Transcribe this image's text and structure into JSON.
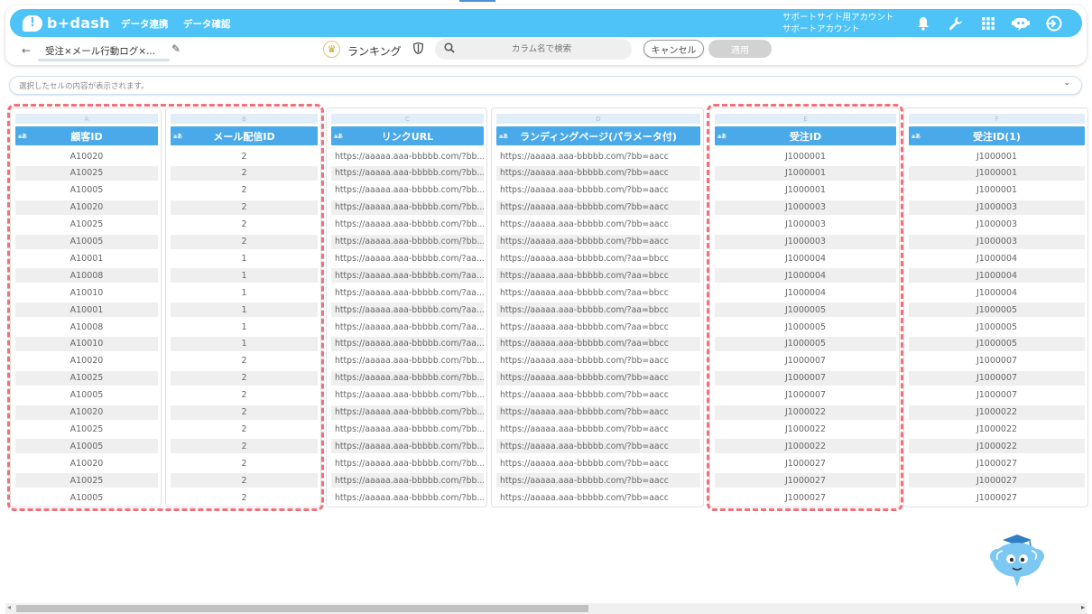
{
  "app": {
    "logo_text": "b+dash",
    "nav": [
      "データ連携",
      "データ確認"
    ],
    "account_line1": "サポートサイト用アカウント",
    "account_line2": "サポートアカウント",
    "icons": [
      "bell-icon",
      "wrench-icon",
      "apps-grid-icon",
      "chat-bot-icon",
      "logout-icon"
    ]
  },
  "toolbar": {
    "back": "←",
    "breadcrumb": "受注×メール行動ログ×...",
    "ranking_label": "ランキング",
    "search_placeholder": "カラム名で検索",
    "cancel_label": "キャンセル",
    "apply_label": "適用"
  },
  "cellbar": {
    "placeholder": "選択したセルの内容が表示されます。"
  },
  "type_tag": "aあ",
  "columns": [
    {
      "letter": "A",
      "header": "顧客ID",
      "highlighted": true,
      "cells": [
        "A10020",
        "A10025",
        "A10005",
        "A10020",
        "A10025",
        "A10005",
        "A10001",
        "A10008",
        "A10010",
        "A10001",
        "A10008",
        "A10010",
        "A10020",
        "A10025",
        "A10005",
        "A10020",
        "A10025",
        "A10005",
        "A10020",
        "A10025",
        "A10005"
      ]
    },
    {
      "letter": "B",
      "header": "メール配信ID",
      "highlighted": true,
      "cells": [
        "2",
        "2",
        "2",
        "2",
        "2",
        "2",
        "1",
        "1",
        "1",
        "1",
        "1",
        "1",
        "2",
        "2",
        "2",
        "2",
        "2",
        "2",
        "2",
        "2",
        "2"
      ]
    },
    {
      "letter": "C",
      "header": "リンクURL",
      "highlighted": false,
      "cells": [
        "https://aaaaa.aaa-bbbbb.com/?bb...",
        "https://aaaaa.aaa-bbbbb.com/?bb...",
        "https://aaaaa.aaa-bbbbb.com/?bb...",
        "https://aaaaa.aaa-bbbbb.com/?bb...",
        "https://aaaaa.aaa-bbbbb.com/?bb...",
        "https://aaaaa.aaa-bbbbb.com/?bb...",
        "https://aaaaa.aaa-bbbbb.com/?aa...",
        "https://aaaaa.aaa-bbbbb.com/?aa...",
        "https://aaaaa.aaa-bbbbb.com/?aa...",
        "https://aaaaa.aaa-bbbbb.com/?aa...",
        "https://aaaaa.aaa-bbbbb.com/?aa...",
        "https://aaaaa.aaa-bbbbb.com/?aa...",
        "https://aaaaa.aaa-bbbbb.com/?bb...",
        "https://aaaaa.aaa-bbbbb.com/?bb...",
        "https://aaaaa.aaa-bbbbb.com/?bb...",
        "https://aaaaa.aaa-bbbbb.com/?bb...",
        "https://aaaaa.aaa-bbbbb.com/?bb...",
        "https://aaaaa.aaa-bbbbb.com/?bb...",
        "https://aaaaa.aaa-bbbbb.com/?bb...",
        "https://aaaaa.aaa-bbbbb.com/?bb...",
        "https://aaaaa.aaa-bbbbb.com/?bb..."
      ]
    },
    {
      "letter": "D",
      "header": "ランディングページ(パラメータ付)",
      "highlighted": false,
      "cells": [
        "https://aaaaa.aaa-bbbbb.com/?bb=aacc",
        "https://aaaaa.aaa-bbbbb.com/?bb=aacc",
        "https://aaaaa.aaa-bbbbb.com/?bb=aacc",
        "https://aaaaa.aaa-bbbbb.com/?bb=aacc",
        "https://aaaaa.aaa-bbbbb.com/?bb=aacc",
        "https://aaaaa.aaa-bbbbb.com/?bb=aacc",
        "https://aaaaa.aaa-bbbbb.com/?aa=bbcc",
        "https://aaaaa.aaa-bbbbb.com/?aa=bbcc",
        "https://aaaaa.aaa-bbbbb.com/?aa=bbcc",
        "https://aaaaa.aaa-bbbbb.com/?aa=bbcc",
        "https://aaaaa.aaa-bbbbb.com/?aa=bbcc",
        "https://aaaaa.aaa-bbbbb.com/?aa=bbcc",
        "https://aaaaa.aaa-bbbbb.com/?bb=aacc",
        "https://aaaaa.aaa-bbbbb.com/?bb=aacc",
        "https://aaaaa.aaa-bbbbb.com/?bb=aacc",
        "https://aaaaa.aaa-bbbbb.com/?bb=aacc",
        "https://aaaaa.aaa-bbbbb.com/?bb=aacc",
        "https://aaaaa.aaa-bbbbb.com/?bb=aacc",
        "https://aaaaa.aaa-bbbbb.com/?bb=aacc",
        "https://aaaaa.aaa-bbbbb.com/?bb=aacc",
        "https://aaaaa.aaa-bbbbb.com/?bb=aacc"
      ]
    },
    {
      "letter": "E",
      "header": "受注ID",
      "highlighted": true,
      "cells": [
        "J1000001",
        "J1000001",
        "J1000001",
        "J1000003",
        "J1000003",
        "J1000003",
        "J1000004",
        "J1000004",
        "J1000004",
        "J1000005",
        "J1000005",
        "J1000005",
        "J1000007",
        "J1000007",
        "J1000007",
        "J1000022",
        "J1000022",
        "J1000022",
        "J1000027",
        "J1000027",
        "J1000027"
      ]
    },
    {
      "letter": "F",
      "header": "受注ID(1)",
      "highlighted": false,
      "cells": [
        "J1000001",
        "J1000001",
        "J1000001",
        "J1000003",
        "J1000003",
        "J1000003",
        "J1000004",
        "J1000004",
        "J1000004",
        "J1000005",
        "J1000005",
        "J1000005",
        "J1000007",
        "J1000007",
        "J1000007",
        "J1000022",
        "J1000022",
        "J1000022",
        "J1000027",
        "J1000027",
        "J1000027"
      ]
    }
  ],
  "colors": {
    "brand": "#4dc3f7",
    "header": "#4aa9e8",
    "highlight": "#f0717a"
  }
}
